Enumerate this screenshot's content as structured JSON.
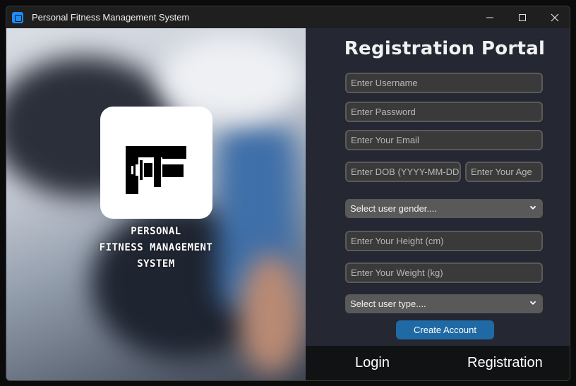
{
  "window": {
    "title": "Personal Fitness Management System",
    "controls": {
      "minimize": "—",
      "maximize": "☐",
      "close": "✕"
    }
  },
  "branding": {
    "line1": "PERSONAL",
    "line2": "FITNESS MANAGEMENT",
    "line3": "SYSTEM"
  },
  "form": {
    "title": "Registration Portal",
    "username_placeholder": "Enter Username",
    "password_placeholder": "Enter Password",
    "email_placeholder": "Enter Your Email",
    "dob_placeholder": "Enter DOB (YYYY-MM-DD)",
    "age_placeholder": "Enter Your Age",
    "gender_select": "Select user gender....",
    "height_placeholder": "Enter Your Height (cm)",
    "weight_placeholder": "Enter Your Weight (kg)",
    "usertype_select": "Select user type....",
    "create_button": "Create Account"
  },
  "nav": {
    "login": "Login",
    "registration": "Registration"
  },
  "colors": {
    "accent": "#1f6aa5",
    "panel": "#252833",
    "app_icon": "#1d8cf8"
  }
}
